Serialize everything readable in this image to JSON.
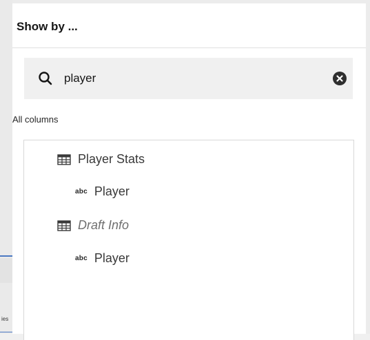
{
  "panel": {
    "title": "Show by ...",
    "search": {
      "value": "player",
      "placeholder": "",
      "icon": "search-icon",
      "clear_icon": "close-circle-icon"
    },
    "section_label": "All columns",
    "tree": [
      {
        "type": "table",
        "label": "Player Stats",
        "icon": "table-icon",
        "italic": false
      },
      {
        "type": "column",
        "label": "Player",
        "icon_text": "abc",
        "italic": false
      },
      {
        "type": "table",
        "label": "Draft Info",
        "icon": "table-icon",
        "italic": true
      },
      {
        "type": "column",
        "label": "Player",
        "icon_text": "abc",
        "italic": false
      }
    ]
  },
  "background": {
    "partial_label": "ies"
  }
}
